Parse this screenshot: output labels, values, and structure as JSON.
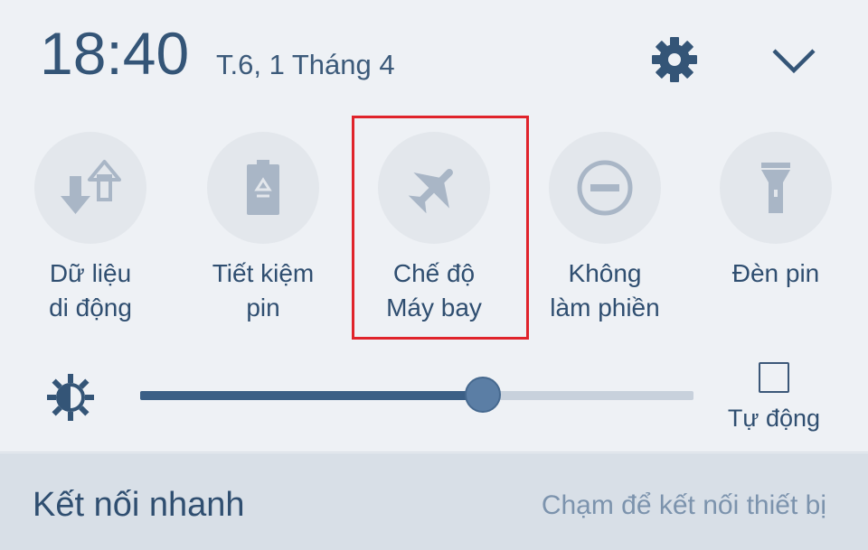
{
  "header": {
    "time": "18:40",
    "date": "T.6, 1 Tháng 4"
  },
  "tiles": [
    {
      "line1": "Dữ liệu",
      "line2": "di động",
      "icon": "mobile-data-icon"
    },
    {
      "line1": "Tiết kiệm",
      "line2": "pin",
      "icon": "battery-saver-icon"
    },
    {
      "line1": "Chế độ",
      "line2": "Máy bay",
      "icon": "airplane-icon"
    },
    {
      "line1": "Không",
      "line2": "làm phiền",
      "icon": "do-not-disturb-icon"
    },
    {
      "line1": "Đèn pin",
      "line2": "",
      "icon": "flashlight-icon"
    }
  ],
  "brightness": {
    "level_percent": 62,
    "auto_label": "Tự động",
    "auto_checked": false
  },
  "quick_connect": {
    "title": "Kết nối nhanh",
    "hint": "Chạm để kết nối thiết bị"
  },
  "colors": {
    "accent": "#345577",
    "highlight": "#e0232b",
    "icon_gray": "#a9b6c6"
  }
}
